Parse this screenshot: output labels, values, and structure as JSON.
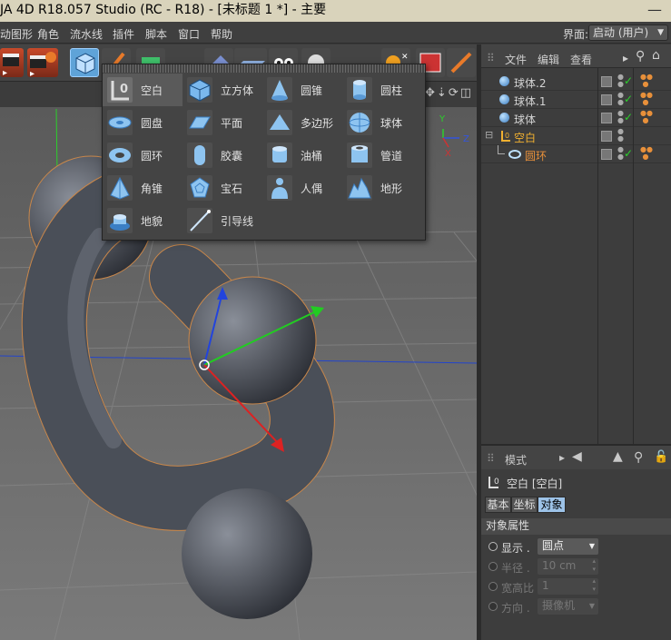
{
  "window": {
    "title": "JA 4D R18.057 Studio (RC - R18) - [未标题 1 *] - 主要"
  },
  "menu": {
    "items": [
      "动图形",
      "角色",
      "流水线",
      "插件",
      "脚本",
      "窗口",
      "帮助"
    ],
    "layout_label": "界面:",
    "layout_value": "启动 (用户)"
  },
  "popup": {
    "items": [
      {
        "label": "空白",
        "icon": "null-object-icon"
      },
      {
        "label": "立方体",
        "icon": "cube-icon"
      },
      {
        "label": "圆锥",
        "icon": "cone-icon"
      },
      {
        "label": "圆柱",
        "icon": "cylinder-icon"
      },
      {
        "label": "圆盘",
        "icon": "disc-icon"
      },
      {
        "label": "平面",
        "icon": "plane-icon"
      },
      {
        "label": "多边形",
        "icon": "polygon-icon"
      },
      {
        "label": "球体",
        "icon": "sphere-icon"
      },
      {
        "label": "圆环",
        "icon": "torus-icon"
      },
      {
        "label": "胶囊",
        "icon": "capsule-icon"
      },
      {
        "label": "油桶",
        "icon": "oil-tank-icon"
      },
      {
        "label": "管道",
        "icon": "tube-icon"
      },
      {
        "label": "角锥",
        "icon": "pyramid-icon"
      },
      {
        "label": "宝石",
        "icon": "platonic-icon"
      },
      {
        "label": "人偶",
        "icon": "figure-icon"
      },
      {
        "label": "地形",
        "icon": "landscape-icon"
      },
      {
        "label": "地貌",
        "icon": "relief-icon"
      },
      {
        "label": "引导线",
        "icon": "guide-icon"
      }
    ]
  },
  "object_manager": {
    "menu": [
      "文件",
      "编辑",
      "查看"
    ],
    "rows": [
      {
        "name": "球体.2",
        "type": "sphere"
      },
      {
        "name": "球体.1",
        "type": "sphere"
      },
      {
        "name": "球体",
        "type": "sphere"
      },
      {
        "name": "空白",
        "type": "null"
      },
      {
        "name": "圆环",
        "type": "torus"
      }
    ]
  },
  "attributes": {
    "mode_label": "模式",
    "object_title": "空白 [空白]",
    "tabs": [
      "基本",
      "坐标",
      "对象"
    ],
    "active_tab": "对象",
    "section": "对象属性",
    "props": [
      {
        "label": "显示 .",
        "value": "圆点",
        "enabled": true
      },
      {
        "label": "半径 .",
        "value": "10 cm",
        "enabled": false
      },
      {
        "label": "宽高比",
        "value": "1",
        "enabled": false
      },
      {
        "label": "方向 .",
        "value": "摄像机",
        "enabled": false
      }
    ]
  },
  "colors": {
    "accent": "#9dc3e8",
    "selected_text": "#f0b030",
    "torus_text": "#e8903a"
  }
}
